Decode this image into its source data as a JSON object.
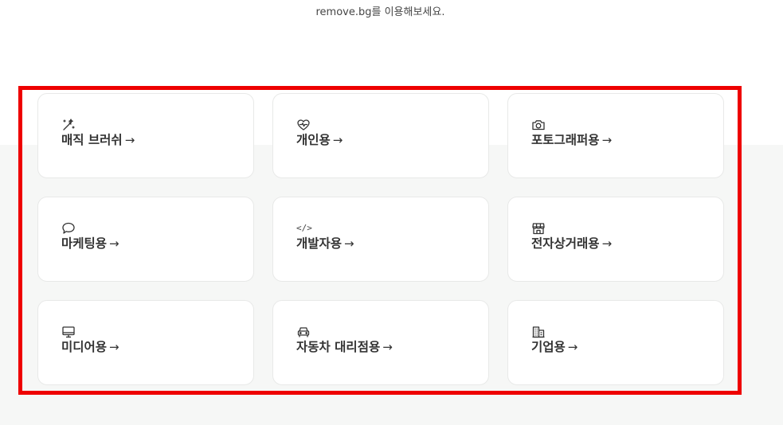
{
  "subtitle": "remove.bg를 이용해보세요.",
  "highlight_color": "#ee0000",
  "cards": [
    {
      "label": "매직 브러쉬",
      "icon": "magic-wand-icon",
      "arrow": "→"
    },
    {
      "label": "개인용",
      "icon": "heart-pulse-icon",
      "arrow": "→"
    },
    {
      "label": "포토그래퍼용",
      "icon": "camera-icon",
      "arrow": "→"
    },
    {
      "label": "마케팅용",
      "icon": "speech-bubble-icon",
      "arrow": "→"
    },
    {
      "label": "개발자용",
      "icon": "code-icon",
      "icon_text": "</>",
      "arrow": "→"
    },
    {
      "label": "전자상거래용",
      "icon": "storefront-icon",
      "arrow": "→"
    },
    {
      "label": "미디어용",
      "icon": "monitor-icon",
      "arrow": "→"
    },
    {
      "label": "자동차 대리점용",
      "icon": "car-icon",
      "arrow": "→"
    },
    {
      "label": "기업용",
      "icon": "building-icon",
      "arrow": "→"
    }
  ]
}
